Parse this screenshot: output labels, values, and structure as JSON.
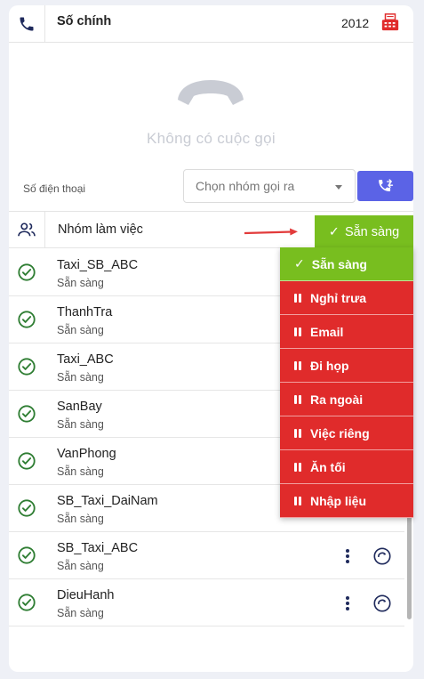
{
  "top": {
    "label": "Số chính",
    "extension": "2012"
  },
  "empty_state": {
    "message": "Không có cuộc gọi"
  },
  "dial": {
    "phone_placeholder": "Số điện thoại",
    "group_placeholder": "Chọn nhóm gọi ra"
  },
  "group_header": {
    "title": "Nhóm làm việc",
    "status_label": "Sẵn sàng"
  },
  "groups": [
    {
      "name": "Taxi_SB_ABC",
      "status": "Sẵn sàng"
    },
    {
      "name": "ThanhTra",
      "status": "Sẵn sàng"
    },
    {
      "name": "Taxi_ABC",
      "status": "Sẵn sàng"
    },
    {
      "name": "SanBay",
      "status": "Sẵn sàng"
    },
    {
      "name": "VanPhong",
      "status": "Sẵn sàng"
    },
    {
      "name": "SB_Taxi_DaiNam",
      "status": "Sẵn sàng"
    },
    {
      "name": "SB_Taxi_ABC",
      "status": "Sẵn sàng"
    },
    {
      "name": "DieuHanh",
      "status": "Sẵn sàng"
    }
  ],
  "status_menu": [
    {
      "label": "Sẵn sàng",
      "kind": "ready"
    },
    {
      "label": "Nghỉ trưa",
      "kind": "pause"
    },
    {
      "label": "Email",
      "kind": "pause"
    },
    {
      "label": "Đi họp",
      "kind": "pause"
    },
    {
      "label": "Ra ngoài",
      "kind": "pause"
    },
    {
      "label": "Việc riêng",
      "kind": "pause"
    },
    {
      "label": "Ăn tối",
      "kind": "pause"
    },
    {
      "label": "Nhập liệu",
      "kind": "pause"
    }
  ],
  "colors": {
    "ready_green": "#78be1f",
    "pause_red": "#e02b2b",
    "accent_blue": "#5b63e6",
    "check_green": "#2e7d32",
    "icon_navy": "#1f2a5c"
  },
  "icons": {
    "phone": "phone-icon",
    "fax": "fax-icon",
    "handset": "handset-icon",
    "transfer": "call-transfer-icon",
    "group": "group-icon",
    "check": "check-circle-icon",
    "more": "more-vertical-icon",
    "cycle": "cycle-icon"
  }
}
